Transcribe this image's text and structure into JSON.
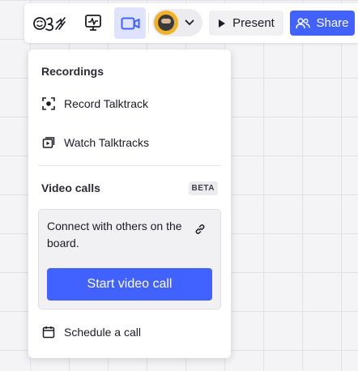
{
  "toolbar": {
    "reactions_icon": "reactions-emoji-icon",
    "board_icon": "board-activity-icon",
    "video_icon": "video-camera-icon",
    "present_label": "Present",
    "share_label": "Share"
  },
  "dropdown": {
    "recordings_title": "Recordings",
    "record_label": "Record Talktrack",
    "watch_label": "Watch Talktracks",
    "video_calls_title": "Video calls",
    "beta_badge": "BETA",
    "connect_text": "Connect with others on the board.",
    "start_call_label": "Start video call",
    "schedule_label": "Schedule a call"
  },
  "colors": {
    "accent": "#4262ff",
    "active_bg": "#dfe3ff",
    "canvas_bg": "#f4f4f6",
    "avatar_bg": "#f0b229"
  }
}
